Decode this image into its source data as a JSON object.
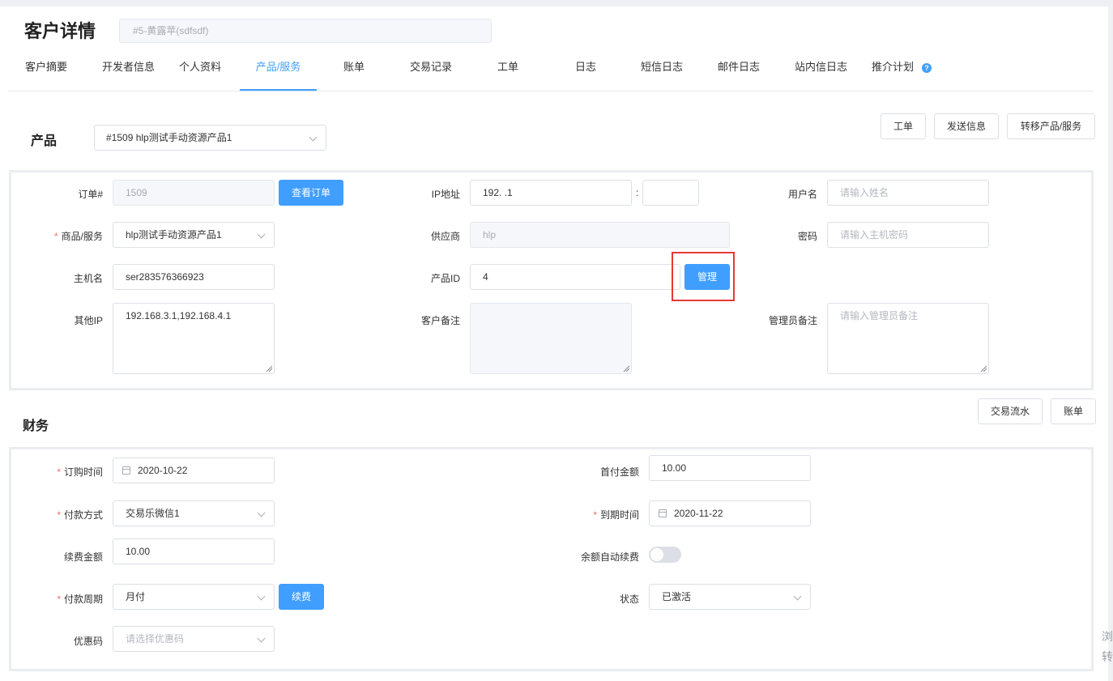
{
  "header": {
    "title": "客户详情",
    "customer_id": "#5-黄露苹(sdfsdf)"
  },
  "tabs": [
    {
      "label": "客户摘要"
    },
    {
      "label": "开发者信息"
    },
    {
      "label": "个人资料"
    },
    {
      "label": "产品/服务"
    },
    {
      "label": "账单"
    },
    {
      "label": "交易记录"
    },
    {
      "label": "工单"
    },
    {
      "label": "日志"
    },
    {
      "label": "短信日志"
    },
    {
      "label": "邮件日志"
    },
    {
      "label": "站内信日志"
    },
    {
      "label": "推介计划"
    }
  ],
  "active_tab": "产品/服务",
  "product_section": {
    "label": "产品",
    "selector_value": "#1509 hlp测试手动资源产品1",
    "actions": [
      "工单",
      "发送信息",
      "转移产品/服务"
    ]
  },
  "product_form": {
    "order_label": "订单#",
    "order_value": "1509",
    "view_order_button": "查看订单",
    "goods_label": "商品/服务",
    "goods_value": "hlp测试手动资源产品1",
    "hostname_label": "主机名",
    "hostname_value": "ser283576366923",
    "other_ip_label": "其他IP",
    "other_ip_value": "192.168.3.1,192.168.4.1",
    "ip_label": "IP地址",
    "ip_value": "192.    .1",
    "port_colon": ":",
    "port_value": "",
    "supplier_label": "供应商",
    "supplier_value": "hlp",
    "product_id_label": "产品ID",
    "product_id_value": "4",
    "manage_button": "管理",
    "customer_note_label": "客户备注",
    "customer_note_value": "",
    "username_label": "用户名",
    "username_placeholder": "请输入姓名",
    "password_label": "密码",
    "password_placeholder": "请输入主机密码",
    "admin_note_label": "管理员备注",
    "admin_note_placeholder": "请输入管理员备注"
  },
  "finance_section": {
    "label": "财务",
    "actions": [
      "交易流水",
      "账单"
    ]
  },
  "finance_form": {
    "order_time_label": "订购时间",
    "order_time_value": "2020-10-22",
    "payment_method_label": "付款方式",
    "payment_method_value": "交易乐微信1",
    "renew_amount_label": "续费金额",
    "renew_amount_value": "10.00",
    "payment_cycle_label": "付款周期",
    "payment_cycle_value": "月付",
    "renew_button": "续费",
    "coupon_label": "优惠码",
    "coupon_placeholder": "请选择优惠码",
    "first_payment_label": "首付金额",
    "first_payment_value": "10.00",
    "due_date_label": "到期时间",
    "due_date_value": "2020-11-22",
    "auto_renew_label": "余额自动续费",
    "auto_renew_on": false,
    "status_label": "状态",
    "status_value": "已激活"
  },
  "side_watermark": [
    "浏",
    "转"
  ],
  "colors": {
    "primary": "#409eff",
    "required": "#f56c6c",
    "highlight_box": "#e53935"
  }
}
